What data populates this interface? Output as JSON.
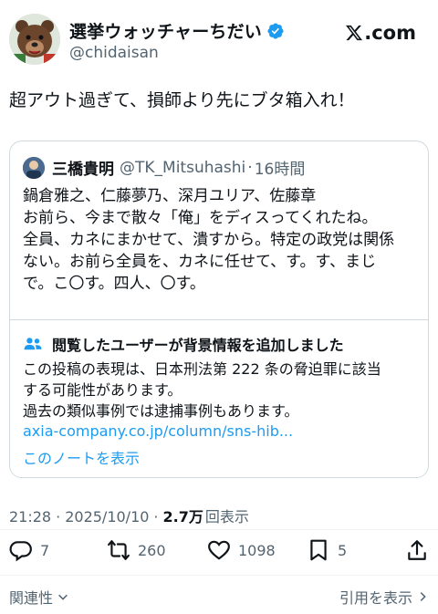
{
  "author": {
    "display_name": "選挙ウォッチャーちだい",
    "handle": "@chidaisan",
    "verified": true,
    "avatar_icon": "bear-avatar-icon"
  },
  "site": {
    "label": ".com",
    "logo_icon": "x-logo-icon"
  },
  "tweet": {
    "text": "超アウト過ぎて、損師より先にブタ箱入れ！"
  },
  "quoted": {
    "display_name": "三橋貴明",
    "handle": "@TK_Mitsuhashi",
    "dot": "·",
    "time": "16時間",
    "lines": [
      "鍋倉雅之、仁藤夢乃、深月ユリア、佐藤章",
      "お前ら、今まで散々「俺」をディスってくれたね。",
      "全員、カネにまかせて、潰すから。特定の政党は関係",
      "ない。お前ら全員を、カネに任せて、す。す、まじ",
      "で。こ〇す。四人、〇す。"
    ]
  },
  "note": {
    "title": "閲覧したユーザーが背景情報を追加しました",
    "lines": [
      "この投稿の表現は、日本刑法第 222 条の脅迫罪に該当",
      "する可能性があります。",
      "過去の類似事例では逮捕事例もあります。"
    ],
    "link": "axia-company.co.jp/column/sns-hib...",
    "show_label": "このノートを表示",
    "icon": "people-icon"
  },
  "meta": {
    "time": "21:28",
    "sep": "·",
    "date": "2025/10/10",
    "views_count": "2.7万",
    "views_label": "回表示"
  },
  "actions": {
    "replies": "7",
    "retweets": "260",
    "likes": "1098",
    "bookmarks": "5"
  },
  "footer": {
    "related_label": "関連性",
    "quotes_label": "引用を表示"
  },
  "colors": {
    "text": "#0f1419",
    "secondary": "#536471",
    "link": "#1d9bf0",
    "border": "#cfd9de",
    "verified": "#1d9bf0"
  }
}
